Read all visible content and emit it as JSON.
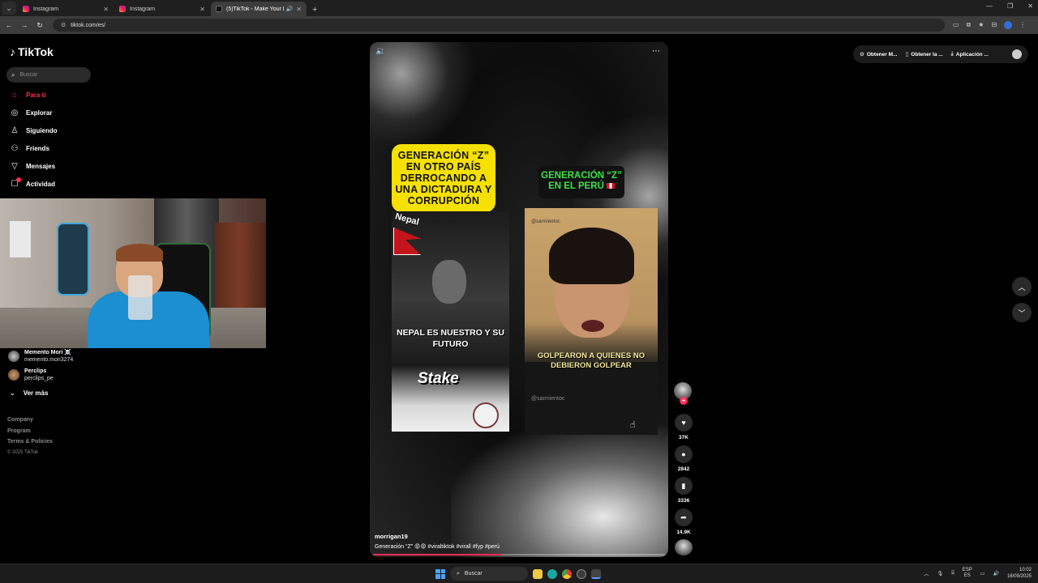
{
  "browser": {
    "tabs": [
      {
        "title": "Instagram",
        "icon": "instagram-icon",
        "active": false
      },
      {
        "title": "Instagram",
        "icon": "instagram-icon",
        "active": false
      },
      {
        "title": "(5)TikTok - Make Your Day",
        "icon": "tiktok-icon",
        "active": true
      }
    ],
    "url": "tiktok.com/es/"
  },
  "sidebar": {
    "logo": "TikTok",
    "search_placeholder": "Buscar",
    "nav": [
      {
        "label": "Para ti",
        "icon": "home-icon",
        "active": true
      },
      {
        "label": "Explorar",
        "icon": "compass-icon",
        "active": false
      },
      {
        "label": "Siguiendo",
        "icon": "following-icon",
        "active": false
      },
      {
        "label": "Friends",
        "icon": "friends-icon",
        "active": false
      },
      {
        "label": "Mensajes",
        "icon": "send-icon",
        "active": false
      },
      {
        "label": "Actividad",
        "icon": "activity-icon",
        "active": false
      }
    ],
    "following": [
      {
        "name": "Memento Mori ☠️",
        "handle": "memento.mori3274"
      },
      {
        "name": "Perclips",
        "handle": "perclips_pe"
      }
    ],
    "ver_mas": "Ver más",
    "footer": [
      "Company",
      "Program",
      "Terms & Policies"
    ],
    "copyright": "© 2025 TikTok"
  },
  "video": {
    "left_banner": "GENERACIÓN “Z” EN OTRO PAÍS DERROCANDO A UNA DICTADURA Y CORRUPCIÓN",
    "right_banner": "GENERACIÓN “Z” EN EL PERÚ",
    "left_label": "Nepal",
    "left_caption": "NEPAL ES NUESTRO Y SU FUTURO",
    "left_brand": "Stake",
    "right_handle": "@sarmientoc.",
    "right_caption": "GOLPEARON A QUIENES NO DEBIERON GOLPEAR",
    "right_watermark": "@sarmientoc",
    "author": "morrigan19",
    "description": "Generación “Z” 😡😡 #viraltiktok #virall #fyp #perú",
    "progress": 0.44
  },
  "actions": {
    "likes": "37K",
    "comments": "2842",
    "saves": "3336",
    "shares": "14.9K"
  },
  "top_pills": [
    "Obtener M...",
    "Obtener la ...",
    "Aplicación ..."
  ],
  "taskbar": {
    "search": "Buscar",
    "lang1": "ESP",
    "lang2": "ES",
    "time": "10:02",
    "date": "16/09/2025"
  }
}
